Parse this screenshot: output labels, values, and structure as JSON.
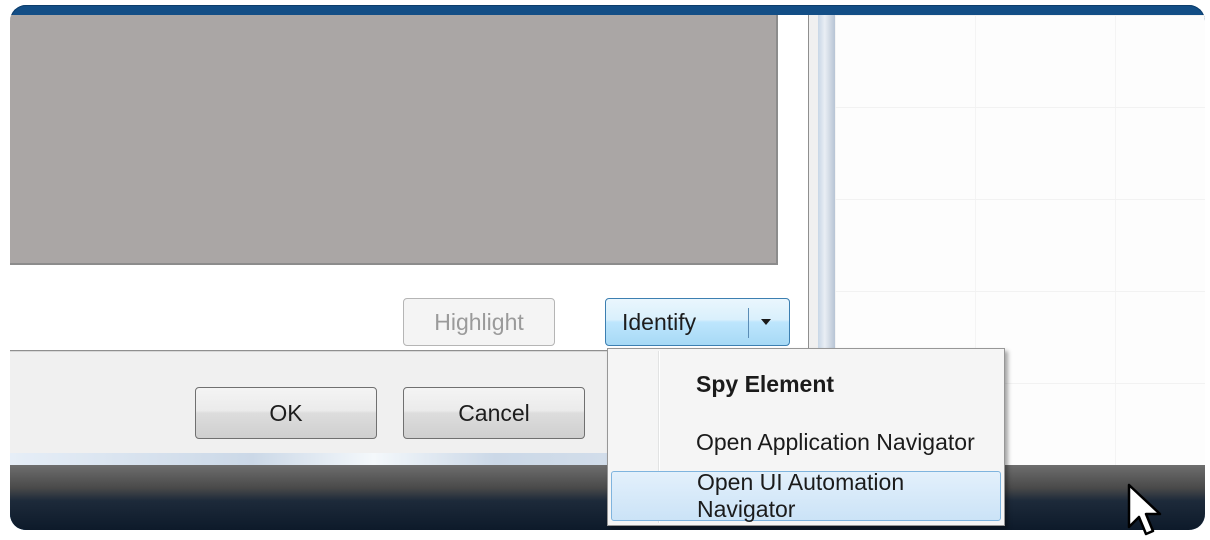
{
  "dialog": {
    "buttons": {
      "highlight": "Highlight",
      "identify": "Identify",
      "ok": "OK",
      "cancel": "Cancel"
    }
  },
  "identify_menu": {
    "items": [
      {
        "label": "Spy Element",
        "bold": true,
        "hovered": false
      },
      {
        "label": "Open Application Navigator",
        "bold": false,
        "hovered": false
      },
      {
        "label": "Open UI Automation Navigator",
        "bold": false,
        "hovered": true
      }
    ]
  },
  "icons": {
    "dropdown": "chevron-down-icon",
    "pointer": "mouse-pointer-icon"
  },
  "colors": {
    "frame_border": "#134e86",
    "preview_area": "#aaa6a5",
    "identify_button": "#bee6fd",
    "menu_hover": "#cbe3f7"
  }
}
